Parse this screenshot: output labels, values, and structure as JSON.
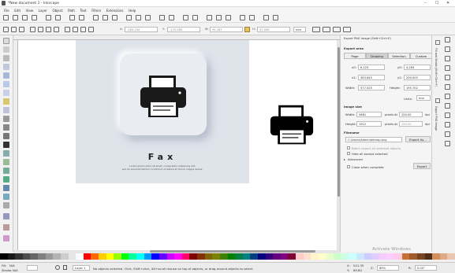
{
  "window": {
    "title": "*New document 1 - Inkscape"
  },
  "menu": [
    "File",
    "Edit",
    "View",
    "Layer",
    "Object",
    "Path",
    "Text",
    "Filters",
    "Extensions",
    "Help"
  ],
  "toolctl": {
    "x_label": "X:",
    "x_value": "-263.294",
    "y_label": "Y:",
    "y_value": "-170.085",
    "w_label": "W:",
    "w_value": "95.187",
    "h_label": "H:",
    "h_value": "47.006",
    "unit": "mm"
  },
  "canvas": {
    "fax_title": "Fax",
    "lorem_line1": "Lorem ipsum dolor sit amet, consectetur adipiscing elit,",
    "lorem_line2": "sed do eiusmod tempor incididunt ut labore et dolore magna aliqua."
  },
  "export_panel": {
    "title": "Export PNG Image (Shift+Ctrl+E)",
    "export_area_label": "Export area",
    "tabs": [
      "Page",
      "Drawing",
      "Selection",
      "Custom"
    ],
    "x0_label": "x0:",
    "x0": "6.123",
    "y0_label": "y0:",
    "y0": "4.283",
    "x1_label": "x1:",
    "x1": "583.645",
    "y1_label": "y1:",
    "y1": "200.005",
    "width_label": "Width:",
    "width": "577.525",
    "height_label": "Height:",
    "height": "195.702",
    "units_label": "Units:",
    "units": "mm",
    "image_size_label": "Image size",
    "img_width_label": "Width:",
    "img_width": "5681",
    "img_height_label": "Height:",
    "img_height": "1912",
    "pixels_at": "pixels at",
    "dpi_value": "250.00",
    "dpi_value2": "250.00",
    "dpi": "dpi",
    "filename_label": "Filename",
    "filename": "C:\\Users\\Admin\\bitmap.png",
    "export_as_btn": "Export As...",
    "batch_label": "Batch export all selected objects",
    "hide_label": "Hide all except selected",
    "advanced_label": "Advanced",
    "close_label": "Close when complete",
    "export_btn": "Export"
  },
  "dock": {
    "label1": "Fill and Stroke (Shift+Ctrl+F)",
    "label2": "Export PNG Image"
  },
  "palette_colors": [
    "#000000",
    "#1a1a1a",
    "#333333",
    "#4d4d4d",
    "#666666",
    "#808080",
    "#999999",
    "#b3b3b3",
    "#cccccc",
    "#e6e6e6",
    "#ffffff",
    "#ff0000",
    "#ff6600",
    "#ffcc00",
    "#ffff00",
    "#99ff00",
    "#00ff00",
    "#00ff99",
    "#00ffff",
    "#0099ff",
    "#0000ff",
    "#6600ff",
    "#cc00ff",
    "#ff00ff",
    "#ff0066",
    "#800000",
    "#803300",
    "#806600",
    "#808000",
    "#408000",
    "#008000",
    "#008040",
    "#008080",
    "#004080",
    "#000080",
    "#330080",
    "#660080",
    "#800080",
    "#800033",
    "#ffcccc",
    "#ffe0cc",
    "#fff5cc",
    "#ffffcc",
    "#e6ffcc",
    "#ccffcc",
    "#ccffe6",
    "#ccffff",
    "#cce6ff",
    "#ccccff",
    "#e0ccff",
    "#f5ccff",
    "#ffccff",
    "#ffcce6",
    "#c87137",
    "#a05a2c",
    "#784421",
    "#502d16",
    "#d38d5f",
    "#deaa87",
    "#e9c6af"
  ],
  "status": {
    "fill_label": "Fill:",
    "fill_value": "N/A",
    "stroke_label": "Stroke:",
    "stroke_value": "N/A",
    "layer": "Layer 1",
    "message": "No objects selected. Click, Shift+click, Alt+scroll mouse on top of objects, or drag around objects to select.",
    "x_label": "X:",
    "x": "541.35",
    "y_label": "Y:",
    "y": "89.80",
    "z_label": "Z:",
    "zoom": "89%",
    "r_label": "R:",
    "rotation": "0.00°"
  },
  "watermark": "Activate Windows"
}
